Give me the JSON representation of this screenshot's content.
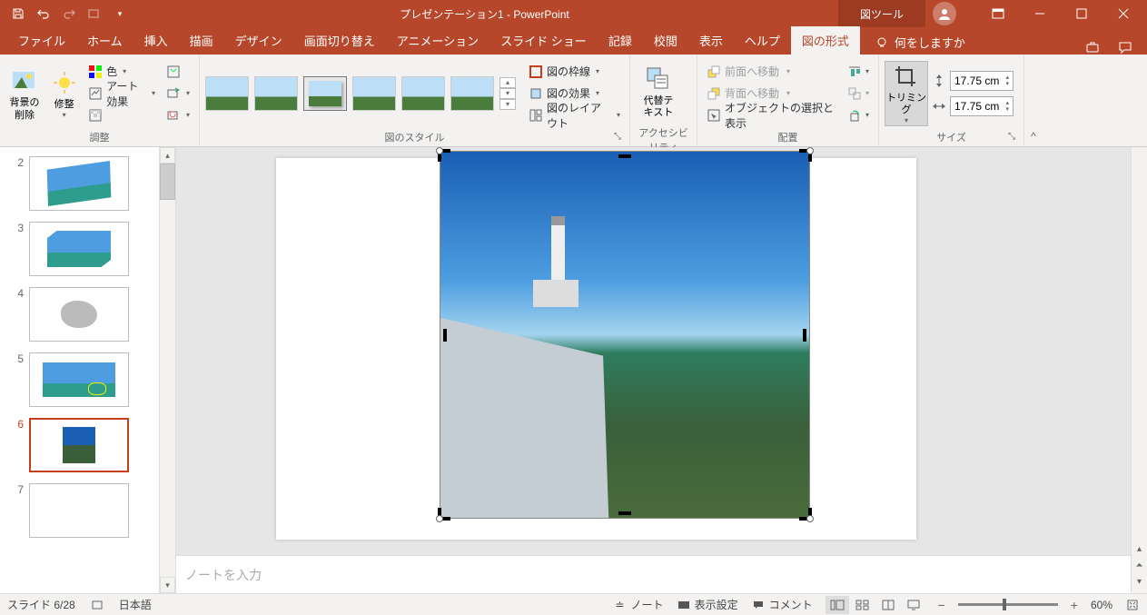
{
  "titlebar": {
    "doc_title": "プレゼンテーション1 - PowerPoint",
    "tool_tab": "図ツール"
  },
  "tabs": {
    "items": [
      "ファイル",
      "ホーム",
      "挿入",
      "描画",
      "デザイン",
      "画面切り替え",
      "アニメーション",
      "スライド ショー",
      "記録",
      "校閲",
      "表示",
      "ヘルプ",
      "図の形式"
    ],
    "tell_me": "何をしますか"
  },
  "ribbon": {
    "remove_bg": "背景の\n削除",
    "corrections": "修整",
    "color": "色",
    "artistic": "アート効果",
    "group_adjust": "調整",
    "group_styles": "図のスタイル",
    "border": "図の枠線",
    "effects": "図の効果",
    "layout": "図のレイアウト",
    "alt_text": "代替テ\nキスト",
    "group_access": "アクセシビリティ",
    "bring_fwd": "前面へ移動",
    "send_back": "背面へ移動",
    "selection_pane": "オブジェクトの選択と表示",
    "group_arrange": "配置",
    "crop": "トリミング",
    "height": "17.75 cm",
    "width": "17.75 cm",
    "group_size": "サイズ"
  },
  "slides": {
    "items": [
      {
        "num": "2"
      },
      {
        "num": "3"
      },
      {
        "num": "4"
      },
      {
        "num": "5"
      },
      {
        "num": "6"
      },
      {
        "num": "7"
      }
    ]
  },
  "notes": {
    "placeholder": "ノートを入力"
  },
  "status": {
    "slide_indicator": "スライド 6/28",
    "language": "日本語",
    "notes_btn": "ノート",
    "display_settings": "表示設定",
    "comments": "コメント",
    "zoom": "60%"
  }
}
